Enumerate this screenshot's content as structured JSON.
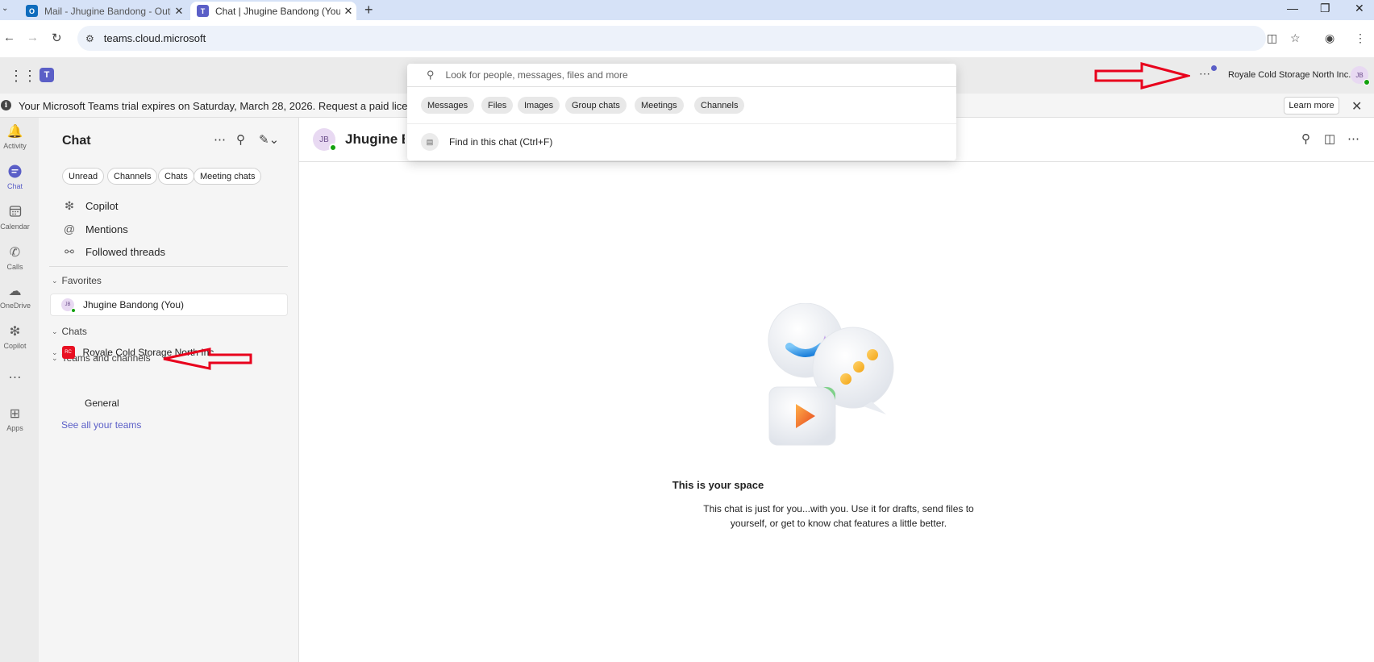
{
  "browser": {
    "tabs": [
      {
        "title": "Mail - Jhugine Bandong - Outlo",
        "icon": "outlook-icon"
      },
      {
        "title": "Chat | Jhugine Bandong (You) |",
        "icon": "teams-icon"
      }
    ],
    "url": "teams.cloud.microsoft"
  },
  "teams_bar": {
    "org_name": "Royale Cold Storage North Inc.",
    "user_initials": "JB"
  },
  "search": {
    "placeholder": "Look for people, messages, files and more",
    "scopes": [
      "Messages",
      "Files",
      "Images",
      "Group chats",
      "Meetings",
      "Channels"
    ],
    "find_in_chat": "Find in this chat (Ctrl+F)"
  },
  "banner": {
    "text": "Your Microsoft Teams trial expires on Saturday, March 28, 2026. Request a paid license t",
    "learn_more": "Learn more"
  },
  "rail": {
    "items": [
      {
        "label": "Activity",
        "icon": "bell-icon"
      },
      {
        "label": "Chat",
        "icon": "chat-icon"
      },
      {
        "label": "Calendar",
        "icon": "calendar-icon"
      },
      {
        "label": "Calls",
        "icon": "phone-icon"
      },
      {
        "label": "OneDrive",
        "icon": "cloud-icon"
      },
      {
        "label": "Copilot",
        "icon": "copilot-icon"
      },
      {
        "label": "Apps",
        "icon": "apps-icon"
      }
    ]
  },
  "chat_list": {
    "title": "Chat",
    "filters": [
      "Unread",
      "Channels",
      "Chats",
      "Meeting chats"
    ],
    "quick_items": [
      "Copilot",
      "Mentions",
      "Followed threads"
    ],
    "sections": {
      "favorites": "Favorites",
      "chats": "Chats",
      "teams": "Teams and channels"
    },
    "favorite_chat": {
      "name": "Jhugine Bandong (You)",
      "initials": "JB"
    },
    "team": {
      "name": "Royale Cold Storage North Inc.",
      "initials": "RC",
      "channel": "General"
    },
    "see_all": "See all your teams"
  },
  "chat": {
    "header_name": "Jhugine Bandong (You)",
    "initials": "JB",
    "empty_title": "This is your space",
    "empty_text": "This chat is just for you...with you. Use it for drafts, send files to yourself, or get to know chat features a little better."
  },
  "colors": {
    "brand": "#5b5fc7",
    "presence": "#13a10e",
    "annotation": "#e8001c"
  }
}
